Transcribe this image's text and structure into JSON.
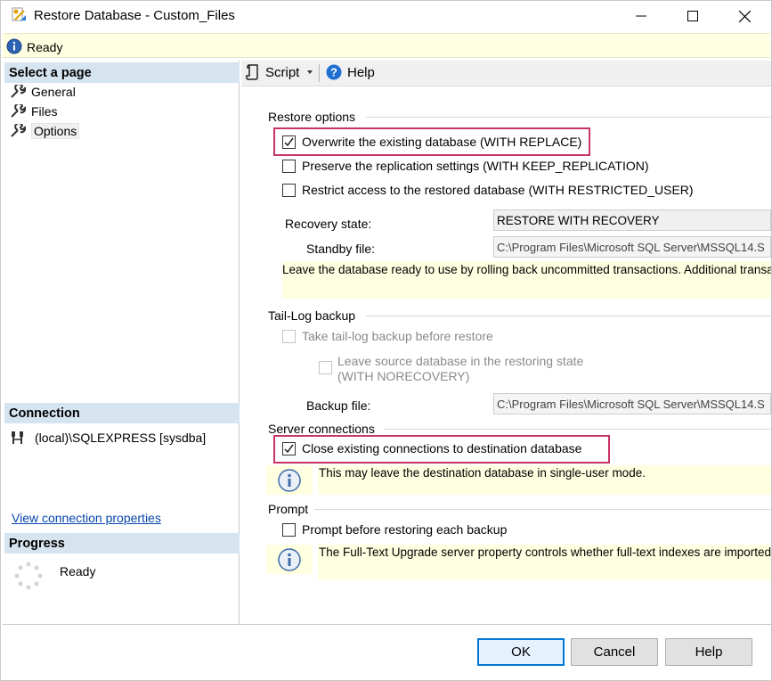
{
  "window": {
    "title": "Restore Database - Custom_Files"
  },
  "status": {
    "text": "Ready"
  },
  "left": {
    "select_page_header": "Select a page",
    "pages": [
      {
        "label": "General"
      },
      {
        "label": "Files"
      },
      {
        "label": "Options",
        "selected": true
      }
    ],
    "connection_header": "Connection",
    "connection_text": "(local)\\SQLEXPRESS [sysdba]",
    "view_connection_link": "View connection properties",
    "progress_header": "Progress",
    "progress_status": "Ready"
  },
  "toolbar": {
    "script_label": "Script",
    "help_label": "Help"
  },
  "restore_options": {
    "title": "Restore options",
    "overwrite": {
      "label": "Overwrite the existing database (WITH REPLACE)",
      "checked": true
    },
    "preserve_replication": {
      "label": "Preserve the replication settings (WITH KEEP_REPLICATION)",
      "checked": false
    },
    "restrict_access": {
      "label": "Restrict access to the restored database (WITH RESTRICTED_USER)",
      "checked": false
    },
    "recovery_state_label": "Recovery state:",
    "recovery_state_value": "RESTORE WITH RECOVERY",
    "standby_file_label": "Standby file:",
    "standby_file_value": "C:\\Program Files\\Microsoft SQL Server\\MSSQL14.S",
    "recovery_note": "Leave the database ready to use by rolling back uncommitted transactions. Additional transa"
  },
  "tail_log": {
    "title": "Tail-Log backup",
    "take_backup": {
      "label": "Take tail-log backup before restore",
      "checked": false
    },
    "leave_source_line1": "Leave source database in the restoring state",
    "leave_source_line2": "(WITH NORECOVERY)",
    "backup_file_label": "Backup file:",
    "backup_file_value": "C:\\Program Files\\Microsoft SQL Server\\MSSQL14.S"
  },
  "server_connections": {
    "title": "Server connections",
    "close_existing": {
      "label": "Close existing connections to destination database",
      "checked": true
    },
    "note": "This may leave the destination database in single-user mode."
  },
  "prompt": {
    "title": "Prompt",
    "prompt_before": {
      "label": "Prompt before restoring each backup",
      "checked": false
    },
    "note": "The Full-Text Upgrade server property controls whether full-text indexes are imported, r"
  },
  "buttons": {
    "ok": "OK",
    "cancel": "Cancel",
    "help": "Help"
  },
  "colors": {
    "highlight": "#c8336a",
    "section_header_bg": "#d6e4f0",
    "note_bg": "#ffffe1",
    "link": "#0645ad",
    "primary_border": "#0078d7"
  },
  "icons": {
    "app": "restore-database-icon",
    "status": "info-icon",
    "page": "wrench-icon",
    "connection": "server-connection-icon",
    "progress": "spinner-icon",
    "script": "script-icon",
    "help": "help-icon"
  }
}
